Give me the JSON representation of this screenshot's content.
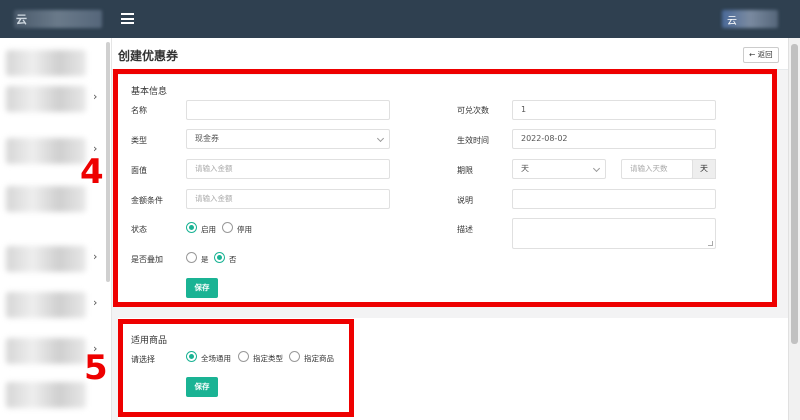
{
  "topbar": {
    "brand": "云",
    "avatar_text": "云"
  },
  "header": {
    "title": "创建优惠券",
    "back_label": "← 返回"
  },
  "annotations": {
    "box1_number": "4",
    "box2_number": "5"
  },
  "basic": {
    "section_title": "基本信息",
    "name_label": "名称",
    "name_value": "",
    "type_label": "类型",
    "type_value": "现金券",
    "face_label": "面值",
    "face_placeholder": "请输入金额",
    "amount_cond_label": "金额条件",
    "amount_cond_placeholder": "请输入金额",
    "status_label": "状态",
    "status_options": [
      "启用",
      "停用"
    ],
    "stack_label": "是否叠加",
    "stack_options": [
      "是",
      "否"
    ],
    "redeem_label": "可兑次数",
    "redeem_value": "1",
    "effective_label": "生效时间",
    "effective_value": "2022-08-02",
    "period_label": "期限",
    "period_unit_value": "天",
    "period_days_placeholder": "请输入天数",
    "period_addon": "天",
    "note_label": "说明",
    "desc_label": "描述",
    "save_label": "保存"
  },
  "goods": {
    "section_title": "适用商品",
    "select_label": "请选择",
    "options": [
      "全场通用",
      "指定类型",
      "指定商品"
    ],
    "save_label": "保存"
  },
  "colors": {
    "accent": "#1ab394",
    "topbar": "#2f4050",
    "annotation": "#ee0000"
  },
  "icons": [
    "menu-icon",
    "back-arrow-icon",
    "chevron-right-icon",
    "chevron-down-icon"
  ]
}
